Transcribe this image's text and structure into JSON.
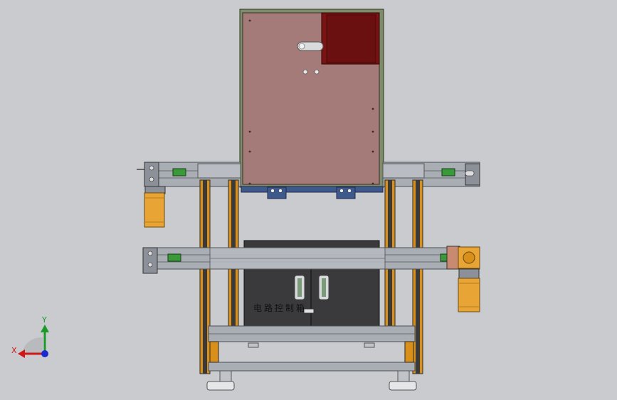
{
  "model": {
    "cabinet_label": "电路控制箱"
  },
  "triad": {
    "x_label": "X",
    "y_label": "Y",
    "colors": {
      "x": "#d01818",
      "y": "#1a9a2a",
      "z": "#1a2ad0"
    }
  },
  "colors": {
    "background": "#c9cbcf",
    "upper_box": "#a47b79",
    "electrical_panel": "#7a1414",
    "frame_orange": "#d9901a",
    "motor_orange": "#e8a535",
    "cabinet_dark": "#3a3a3c",
    "rail_gray": "#a9adb4",
    "bracket_blue": "#3e5a8c",
    "block_green": "#3a9a3a"
  }
}
